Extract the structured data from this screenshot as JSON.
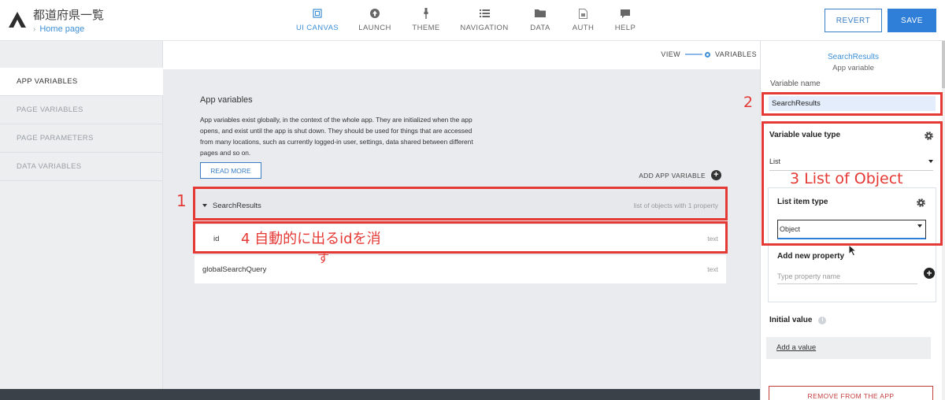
{
  "app": {
    "title": "都道府県一覧",
    "breadcrumb": "Home page"
  },
  "nav": [
    {
      "label": "UI CANVAS",
      "icon": "ui-canvas-icon",
      "active": true
    },
    {
      "label": "LAUNCH",
      "icon": "launch-icon",
      "active": false
    },
    {
      "label": "THEME",
      "icon": "theme-icon",
      "active": false
    },
    {
      "label": "NAVIGATION",
      "icon": "navigation-icon",
      "active": false
    },
    {
      "label": "DATA",
      "icon": "data-icon",
      "active": false
    },
    {
      "label": "AUTH",
      "icon": "auth-icon",
      "active": false
    },
    {
      "label": "HELP",
      "icon": "help-icon",
      "active": false
    }
  ],
  "actions": {
    "revert": "REVERT",
    "save": "SAVE"
  },
  "sidebar": {
    "items": [
      {
        "label": "APP VARIABLES",
        "active": true
      },
      {
        "label": "PAGE VARIABLES",
        "active": false
      },
      {
        "label": "PAGE PARAMETERS",
        "active": false
      },
      {
        "label": "DATA VARIABLES",
        "active": false
      }
    ]
  },
  "view_toggle": {
    "view": "VIEW",
    "variables": "VARIABLES"
  },
  "main": {
    "title": "App variables",
    "description": "App variables exist globally, in the context of the whole app. They are initialized when the app opens, and exist until the app is shut down. They should be used for things that are accessed from many locations, such as currently logged-in user, settings, data shared between different pages and so on.",
    "read_more": "READ MORE",
    "add_variable": "ADD APP VARIABLE",
    "variables": [
      {
        "name": "SearchResults",
        "type": "list of objects with 1 property"
      },
      {
        "name": "id",
        "type": "text"
      },
      {
        "name": "globalSearchQuery",
        "type": "text"
      }
    ]
  },
  "panel": {
    "name": "SearchResults",
    "subtitle": "App variable",
    "variable_name_label": "Variable name",
    "variable_name_value": "SearchResults",
    "value_type_label": "Variable value type",
    "value_type": "List",
    "list_item_type_label": "List item type",
    "list_item_type": "Object",
    "add_property_label": "Add new property",
    "property_placeholder": "Type property name",
    "initial_value_label": "Initial value",
    "add_value": "Add a value",
    "remove": "REMOVE FROM THE APP"
  },
  "annotations": {
    "a1": "1",
    "a2": "2",
    "a3": "3 List of Object",
    "a4_line1": "4 自動的に出るidを消",
    "a4_line2": "す",
    "color": "#e53935"
  },
  "colors": {
    "accent": "#2f7ed8",
    "link": "#3d8fd6",
    "danger": "#c43c3c"
  }
}
